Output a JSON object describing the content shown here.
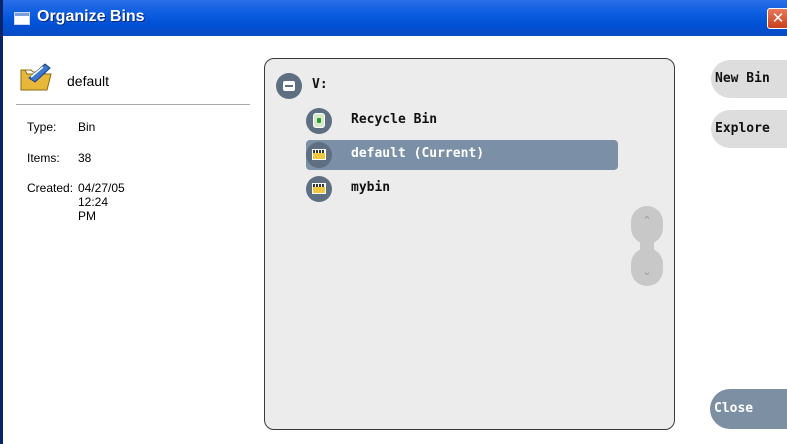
{
  "window": {
    "title": "Organize Bins",
    "close_glyph": "✕"
  },
  "info": {
    "name": "default",
    "icon": "folder-icon",
    "fields": [
      {
        "label": "Type:",
        "value": "Bin"
      },
      {
        "label": "Items:",
        "value": "38"
      },
      {
        "label": "Created:",
        "value": "04/27/05 12:24 PM"
      }
    ]
  },
  "tree": {
    "root": {
      "label": "V:",
      "icon": "collapse-icon"
    },
    "items": [
      {
        "label": "Recycle Bin",
        "icon": "recycle-bin-icon",
        "selected": false
      },
      {
        "label": "default (Current)",
        "icon": "bin-icon",
        "selected": true
      },
      {
        "label": "mybin",
        "icon": "bin-icon",
        "selected": false
      }
    ],
    "scroll": {
      "up_glyph": "⌃",
      "down_glyph": "⌄"
    }
  },
  "buttons": {
    "new_bin": "New Bin",
    "explore": "Explore",
    "close": "Close"
  },
  "colors": {
    "titlebar": "#0a5ce0",
    "selection": "#7b90a6",
    "panel_bg": "#ececec",
    "close_button": "#7d8fa3"
  }
}
